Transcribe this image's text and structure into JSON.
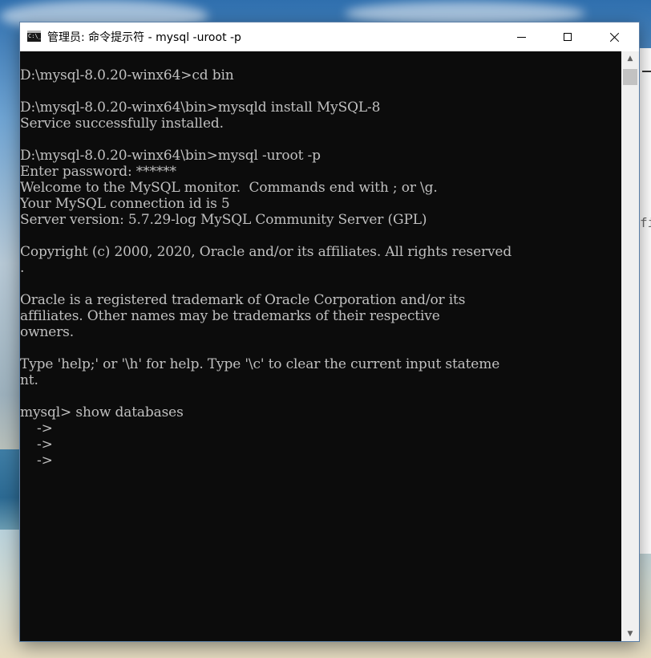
{
  "window": {
    "title": "管理员: 命令提示符 - mysql  -uroot -p"
  },
  "icons": {
    "app": "cmd-icon",
    "minimize": "minimize-icon",
    "maximize": "maximize-icon",
    "close": "close-icon",
    "scroll_up": "chevron-up-icon",
    "scroll_down": "chevron-down-icon"
  },
  "app_icon_text": "C:\\_",
  "console": {
    "lines": [
      "D:\\mysql-8.0.20-winx64>cd bin",
      "",
      "D:\\mysql-8.0.20-winx64\\bin>mysqld install MySQL-8",
      "Service successfully installed.",
      "",
      "D:\\mysql-8.0.20-winx64\\bin>mysql -uroot -p",
      "Enter password: ******",
      "Welcome to the MySQL monitor.  Commands end with ; or \\g.",
      "Your MySQL connection id is 5",
      "Server version: 5.7.29-log MySQL Community Server (GPL)",
      "",
      "Copyright (c) 2000, 2020, Oracle and/or its affiliates. All rights reserved",
      ".",
      "",
      "Oracle is a registered trademark of Oracle Corporation and/or its",
      "affiliates. Other names may be trademarks of their respective",
      "owners.",
      "",
      "Type 'help;' or '\\h' for help. Type '\\c' to clear the current input stateme",
      "nt.",
      "",
      "mysql> show databases",
      "    ->",
      "    ->",
      "    ->"
    ]
  },
  "background_window": {
    "partial_text": "fi"
  },
  "colors": {
    "console_bg": "#0c0c0c",
    "console_text": "#c0c0c0",
    "titlebar_bg": "#ffffff"
  }
}
